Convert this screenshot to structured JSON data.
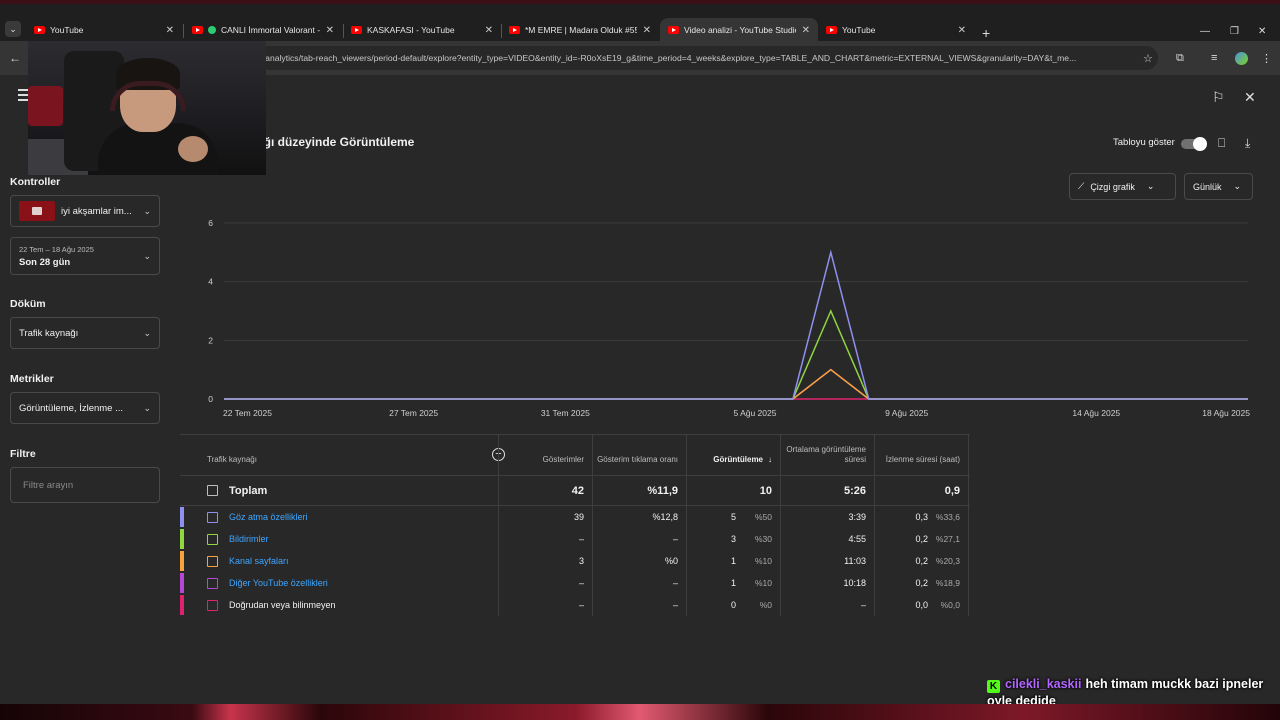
{
  "browser": {
    "tabs": [
      {
        "label": "YouTube",
        "live": false
      },
      {
        "label": "CANLI İmmortal Valorant - ",
        "live": true
      },
      {
        "label": "KASKAFASI - YouTube",
        "live": false
      },
      {
        "label": "*M EMRE | Madara Olduk #555",
        "live": false
      },
      {
        "label": "Video analizi - YouTube Studio",
        "live": false,
        "active": true
      },
      {
        "label": "YouTube",
        "live": false
      }
    ],
    "url": "g/analytics/tab-reach_viewers/period-default/explore?entity_type=VIDEO&entity_id=-R0oXsE19_g&time_period=4_weeks&explore_type=TABLE_AND_CHART&metric=EXTERNAL_VIEWS&granularity=DAY&t_me..."
  },
  "sidebar": {
    "controls_label": "Kontroller",
    "video_title": "iyi akşamlar im...",
    "date_range_small": "22 Tem – 18 Ağu 2025",
    "date_range_main": "Son 28 gün",
    "breakdown_label": "Döküm",
    "breakdown_value": "Trafik kaynağı",
    "metrics_label": "Metrikler",
    "metrics_value": "Görüntüleme, İzlenme ...",
    "filter_label": "Filtre",
    "filter_placeholder": "Filtre arayın"
  },
  "report": {
    "title": "ağı düzeyinde Görüntüleme",
    "show_table_label": "Tabloyu göster",
    "chart_type": "Çizgi grafik",
    "granularity": "Günlük"
  },
  "chart_data": {
    "type": "line",
    "x": [
      "22 Tem 2025",
      "27 Tem 2025",
      "31 Tem 2025",
      "5 Ağu 2025",
      "9 Ağu 2025",
      "14 Ağu 2025",
      "18 Ağu 2025"
    ],
    "ylim": [
      0,
      6
    ],
    "yticks": [
      0,
      2,
      4,
      6
    ],
    "spike": {
      "start_day": 15,
      "peak_day": 16,
      "end_day": 17
    },
    "days": 28,
    "series": [
      {
        "peak": 5,
        "color": "#8f8ff0"
      },
      {
        "peak": 3,
        "color": "#8fd63f"
      },
      {
        "peak": 1,
        "color": "#f7a23a"
      },
      {
        "peak": 1,
        "color": "#b348d6"
      },
      {
        "peak": 0,
        "color": "#e0226e"
      }
    ]
  },
  "table": {
    "headers": {
      "source": "Trafik kaynağı",
      "impressions": "Gösterimler",
      "ctr": "Gösterim tıklama oranı",
      "views": "Görüntüleme",
      "avg_view": "Ortalama görüntüleme süresi",
      "watch_time": "İzlenme süresi (saat)"
    },
    "total": {
      "label": "Toplam",
      "impressions": "42",
      "ctr": "%11,9",
      "views": "10",
      "avg_view": "5:26",
      "watch_time": "0,9"
    },
    "rows": [
      {
        "label": "Göz atma özellikleri",
        "link": true,
        "color": "#8f8ff0",
        "impressions": "39",
        "ctr": "%12,8",
        "views": "5",
        "views_pct": "%50",
        "avg_view": "3:39",
        "watch_time": "0,3",
        "watch_pct": "%33,6"
      },
      {
        "label": "Bildirimler",
        "link": true,
        "color": "#8fd63f",
        "impressions": "–",
        "ctr": "–",
        "views": "3",
        "views_pct": "%30",
        "avg_view": "4:55",
        "watch_time": "0,2",
        "watch_pct": "%27,1"
      },
      {
        "label": "Kanal sayfaları",
        "link": true,
        "color": "#f7a23a",
        "impressions": "3",
        "ctr": "%0",
        "views": "1",
        "views_pct": "%10",
        "avg_view": "11:03",
        "watch_time": "0,2",
        "watch_pct": "%20,3"
      },
      {
        "label": "Diğer YouTube özellikleri",
        "link": true,
        "color": "#b348d6",
        "impressions": "–",
        "ctr": "–",
        "views": "1",
        "views_pct": "%10",
        "avg_view": "10:18",
        "watch_time": "0,2",
        "watch_pct": "%18,9"
      },
      {
        "label": "Doğrudan veya bilinmeyen",
        "link": false,
        "color": "#e0226e",
        "impressions": "–",
        "ctr": "–",
        "views": "0",
        "views_pct": "%0",
        "avg_view": "–",
        "watch_time": "0,0",
        "watch_pct": "%0,0"
      }
    ]
  },
  "chat": {
    "badge": "K",
    "user": "cilekli_kaskii",
    "message": "heh timam muckk bazi ipneler oyle dedide"
  }
}
